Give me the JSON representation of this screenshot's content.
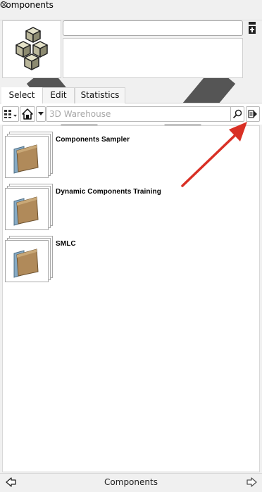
{
  "panel": {
    "title": "Components",
    "close_glyph": "×"
  },
  "preview": {
    "name_value": "",
    "icon": "component-cubes-icon"
  },
  "tabs": [
    {
      "label": "Select",
      "selected": true
    },
    {
      "label": "Edit",
      "selected": false
    },
    {
      "label": "Statistics",
      "selected": false
    }
  ],
  "toolbar": {
    "search_placeholder": "3D Warehouse",
    "search_value": "",
    "icons": [
      "view-options-icon",
      "home-icon",
      "dropdown-arrow-icon",
      "search-icon",
      "details-arrow-icon"
    ]
  },
  "items": [
    {
      "label": "Components Sampler",
      "icon": "folder-icon"
    },
    {
      "label": "Dynamic Components Training",
      "icon": "folder-icon"
    },
    {
      "label": "SMLC",
      "icon": "folder-icon"
    }
  ],
  "status": {
    "title": "Components"
  },
  "colors": {
    "annotation_arrow": "#d93025",
    "folder": "#b08a5a"
  }
}
